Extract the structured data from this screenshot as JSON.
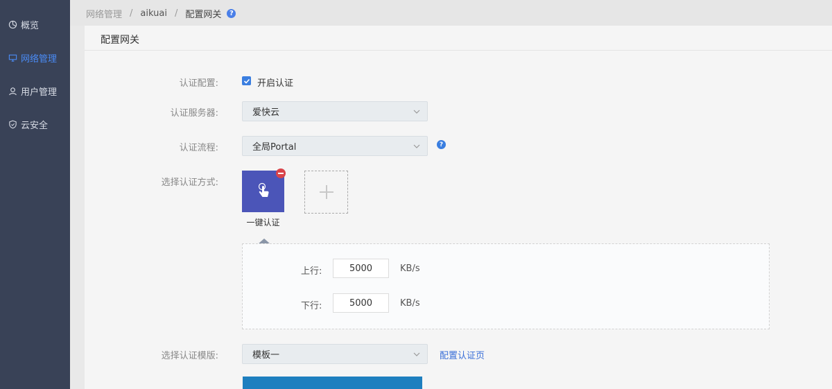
{
  "sidebar": {
    "items": [
      {
        "label": "概览",
        "icon": "pie-chart-icon"
      },
      {
        "label": "网络管理",
        "icon": "monitor-icon",
        "active": true
      },
      {
        "label": "用户管理",
        "icon": "user-icon"
      },
      {
        "label": "云安全",
        "icon": "shield-icon"
      }
    ]
  },
  "breadcrumb": {
    "items": [
      "网络管理",
      "aikuai",
      "配置网关"
    ],
    "separator": "/",
    "help": "?"
  },
  "panel": {
    "title": "配置网关"
  },
  "form": {
    "auth_config_label": "认证配置:",
    "auth_enable_label": "开启认证",
    "auth_enabled": true,
    "auth_server_label": "认证服务器:",
    "auth_server_value": "爱快云",
    "auth_flow_label": "认证流程:",
    "auth_flow_value": "全局Portal",
    "auth_flow_help": "?",
    "method_label": "选择认证方式:",
    "method_name": "一键认证",
    "upstream_label": "上行:",
    "upstream_value": "5000",
    "upstream_unit": "KB/s",
    "downstream_label": "下行:",
    "downstream_value": "5000",
    "downstream_unit": "KB/s",
    "template_label": "选择认证模版:",
    "template_value": "模板一",
    "config_page_link": "配置认证页"
  },
  "colors": {
    "sidebar_bg": "#394257",
    "accent": "#4a8bf5",
    "tile": "#4b55b8",
    "danger": "#d9434a",
    "primary_button": "#1e7fbf"
  }
}
